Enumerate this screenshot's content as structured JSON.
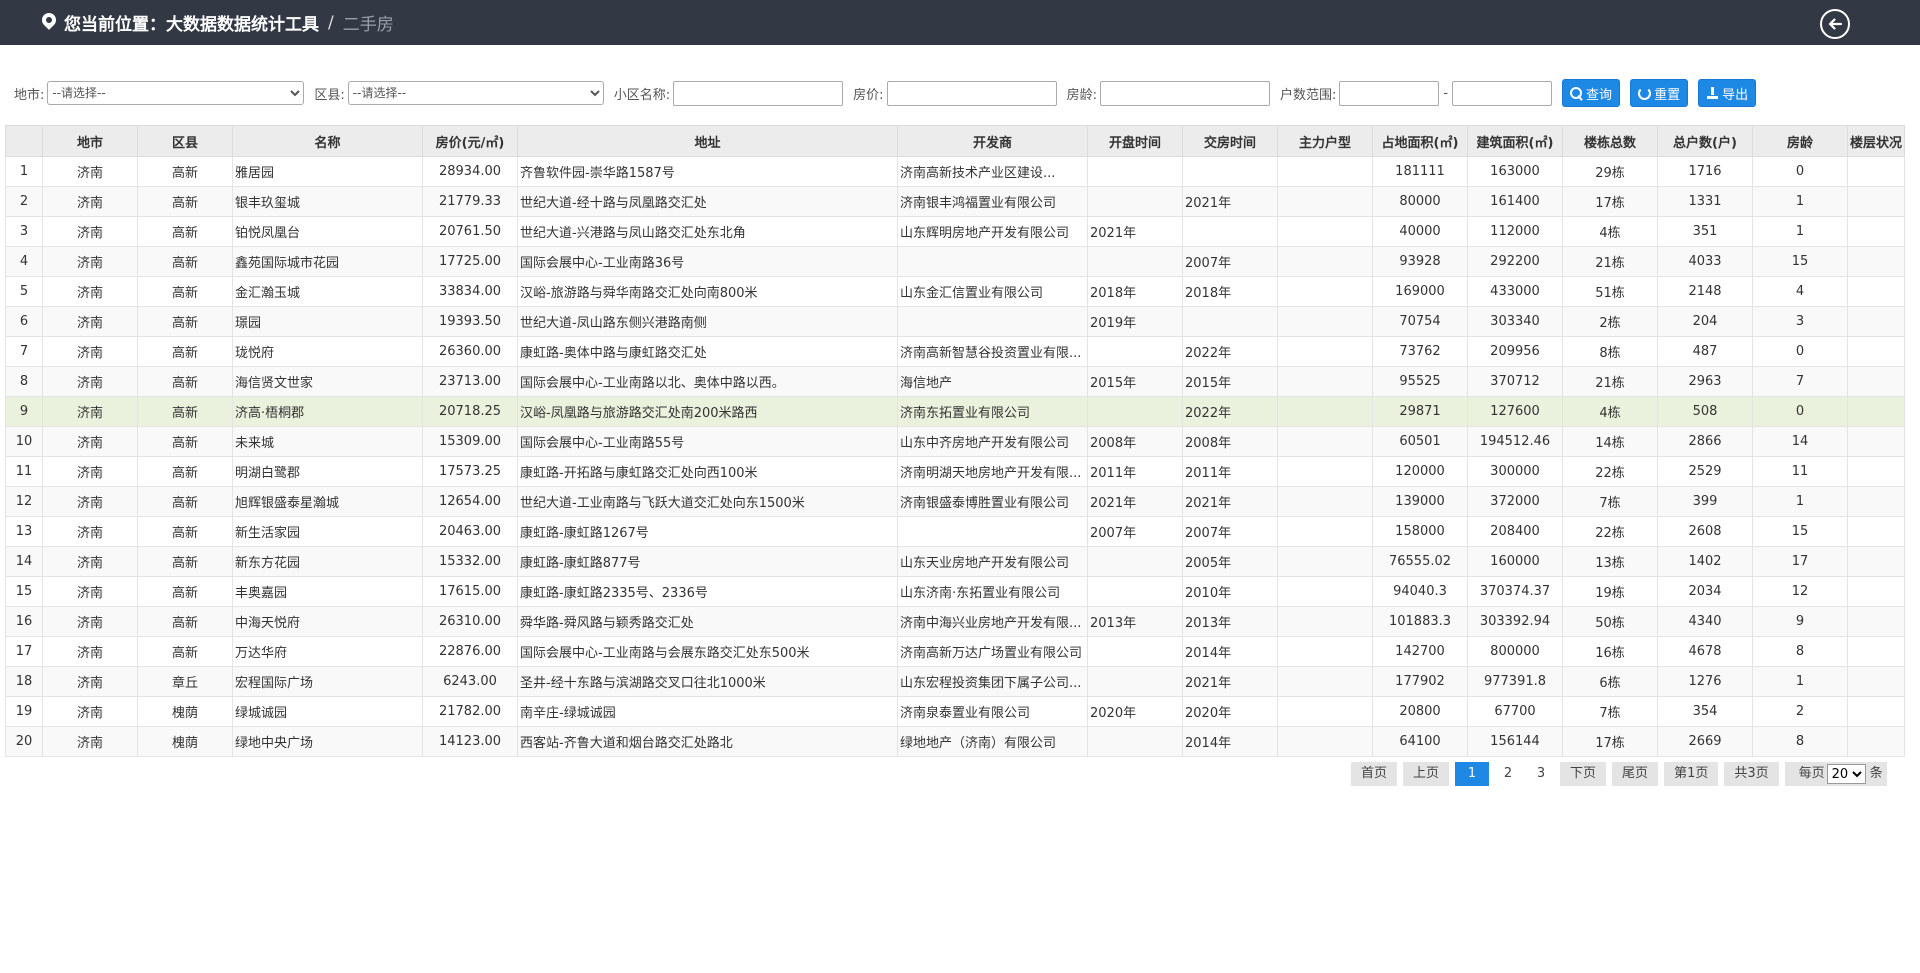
{
  "header": {
    "location_label": "您当前位置：",
    "site": "大数据数据统计工具",
    "separator": "/",
    "page": "二手房"
  },
  "filters": {
    "city_label": "地市:",
    "city_value": "--请选择--",
    "district_label": "区县:",
    "district_value": "--请选择--",
    "community_label": "小区名称:",
    "price_label": "房价:",
    "age_label": "房龄:",
    "households_label": "户数范围:",
    "range_dash": "-",
    "query_label": "查询",
    "reset_label": "重置",
    "export_label": "导出"
  },
  "table": {
    "columns": [
      "",
      "地市",
      "区县",
      "名称",
      "房价(元/㎡)",
      "地址",
      "开发商",
      "开盘时间",
      "交房时间",
      "主力户型",
      "占地面积(㎡)",
      "建筑面积(㎡)",
      "楼栋总数",
      "总户数(户)",
      "房龄",
      "楼层状况"
    ],
    "rows": [
      [
        "1",
        "济南",
        "高新",
        "雅居园",
        "28934.00",
        "齐鲁软件园-崇华路1587号",
        "济南高新技术产业区建设...",
        "",
        "",
        "",
        "181111",
        "163000",
        "29栋",
        "1716",
        "0",
        ""
      ],
      [
        "2",
        "济南",
        "高新",
        "银丰玖玺城",
        "21779.33",
        "世纪大道-经十路与凤凰路交汇处",
        "济南银丰鸿福置业有限公司",
        "",
        "2021年",
        "",
        "80000",
        "161400",
        "17栋",
        "1331",
        "1",
        ""
      ],
      [
        "3",
        "济南",
        "高新",
        "铂悦凤凰台",
        "20761.50",
        "世纪大道-兴港路与凤山路交汇处东北角",
        "山东辉明房地产开发有限公司",
        "2021年",
        "",
        "",
        "40000",
        "112000",
        "4栋",
        "351",
        "1",
        ""
      ],
      [
        "4",
        "济南",
        "高新",
        "鑫苑国际城市花园",
        "17725.00",
        "国际会展中心-工业南路36号",
        "",
        "",
        "2007年",
        "",
        "93928",
        "292200",
        "21栋",
        "4033",
        "15",
        ""
      ],
      [
        "5",
        "济南",
        "高新",
        "金汇瀚玉城",
        "33834.00",
        "汉峪-旅游路与舜华南路交汇处向南800米",
        "山东金汇信置业有限公司",
        "2018年",
        "2018年",
        "",
        "169000",
        "433000",
        "51栋",
        "2148",
        "4",
        ""
      ],
      [
        "6",
        "济南",
        "高新",
        "璟园",
        "19393.50",
        "世纪大道-凤山路东侧兴港路南侧",
        "",
        "2019年",
        "",
        "",
        "70754",
        "303340",
        "2栋",
        "204",
        "3",
        ""
      ],
      [
        "7",
        "济南",
        "高新",
        "珑悦府",
        "26360.00",
        "康虹路-奥体中路与康虹路交汇处",
        "济南高新智慧谷投资置业有限...",
        "",
        "2022年",
        "",
        "73762",
        "209956",
        "8栋",
        "487",
        "0",
        ""
      ],
      [
        "8",
        "济南",
        "高新",
        "海信贤文世家",
        "23713.00",
        "国际会展中心-工业南路以北、奥体中路以西。",
        "海信地产",
        "2015年",
        "2015年",
        "",
        "95525",
        "370712",
        "21栋",
        "2963",
        "7",
        ""
      ],
      [
        "9",
        "济南",
        "高新",
        "济高·梧桐郡",
        "20718.25",
        "汉峪-凤凰路与旅游路交汇处南200米路西",
        "济南东拓置业有限公司",
        "",
        "2022年",
        "",
        "29871",
        "127600",
        "4栋",
        "508",
        "0",
        ""
      ],
      [
        "10",
        "济南",
        "高新",
        "未来城",
        "15309.00",
        "国际会展中心-工业南路55号",
        "山东中齐房地产开发有限公司",
        "2008年",
        "2008年",
        "",
        "60501",
        "194512.46",
        "14栋",
        "2866",
        "14",
        ""
      ],
      [
        "11",
        "济南",
        "高新",
        "明湖白鹭郡",
        "17573.25",
        "康虹路-开拓路与康虹路交汇处向西100米",
        "济南明湖天地房地产开发有限...",
        "2011年",
        "2011年",
        "",
        "120000",
        "300000",
        "22栋",
        "2529",
        "11",
        ""
      ],
      [
        "12",
        "济南",
        "高新",
        "旭辉银盛泰星瀚城",
        "12654.00",
        "世纪大道-工业南路与飞跃大道交汇处向东1500米",
        "济南银盛泰博胜置业有限公司",
        "2021年",
        "2021年",
        "",
        "139000",
        "372000",
        "7栋",
        "399",
        "1",
        ""
      ],
      [
        "13",
        "济南",
        "高新",
        "新生活家园",
        "20463.00",
        "康虹路-康虹路1267号",
        "",
        "2007年",
        "2007年",
        "",
        "158000",
        "208400",
        "22栋",
        "2608",
        "15",
        ""
      ],
      [
        "14",
        "济南",
        "高新",
        "新东方花园",
        "15332.00",
        "康虹路-康虹路877号",
        "山东天业房地产开发有限公司",
        "",
        "2005年",
        "",
        "76555.02",
        "160000",
        "13栋",
        "1402",
        "17",
        ""
      ],
      [
        "15",
        "济南",
        "高新",
        "丰奥嘉园",
        "17615.00",
        "康虹路-康虹路2335号、2336号",
        "山东济南·东拓置业有限公司",
        "",
        "2010年",
        "",
        "94040.3",
        "370374.37",
        "19栋",
        "2034",
        "12",
        ""
      ],
      [
        "16",
        "济南",
        "高新",
        "中海天悦府",
        "26310.00",
        "舜华路-舜风路与颖秀路交汇处",
        "济南中海兴业房地产开发有限...",
        "2013年",
        "2013年",
        "",
        "101883.3",
        "303392.94",
        "50栋",
        "4340",
        "9",
        ""
      ],
      [
        "17",
        "济南",
        "高新",
        "万达华府",
        "22876.00",
        "国际会展中心-工业南路与会展东路交汇处东500米",
        "济南高新万达广场置业有限公司",
        "",
        "2014年",
        "",
        "142700",
        "800000",
        "16栋",
        "4678",
        "8",
        ""
      ],
      [
        "18",
        "济南",
        "章丘",
        "宏程国际广场",
        "6243.00",
        "圣井-经十东路与滨湖路交叉口往北1000米",
        "山东宏程投资集团下属子公司...",
        "",
        "2021年",
        "",
        "177902",
        "977391.8",
        "6栋",
        "1276",
        "1",
        ""
      ],
      [
        "19",
        "济南",
        "槐荫",
        "绿城诚园",
        "21782.00",
        "南辛庄-绿城诚园",
        "济南泉泰置业有限公司",
        "2020年",
        "2020年",
        "",
        "20800",
        "67700",
        "7栋",
        "354",
        "2",
        ""
      ],
      [
        "20",
        "济南",
        "槐荫",
        "绿地中央广场",
        "14123.00",
        "西客站-齐鲁大道和烟台路交汇处路北",
        "绿地地产（济南）有限公司",
        "",
        "2014年",
        "",
        "64100",
        "156144",
        "17栋",
        "2669",
        "8",
        ""
      ]
    ]
  },
  "pager": {
    "first": "首页",
    "prev": "上页",
    "pages": [
      "1",
      "2",
      "3"
    ],
    "next": "下页",
    "last": "尾页",
    "current": "第1页",
    "total": "共3页",
    "per_page_label": "每页",
    "per_page_value": "20",
    "per_page_unit": "条"
  },
  "colors": {
    "header_bg": "#323844",
    "accent": "#1e88e5",
    "highlight_row": "#eaf1dd"
  },
  "icons": {
    "location": "map-pin-icon",
    "back": "arrow-left-circle-icon",
    "query": "search-icon",
    "reset": "refresh-icon",
    "export": "export-icon"
  }
}
